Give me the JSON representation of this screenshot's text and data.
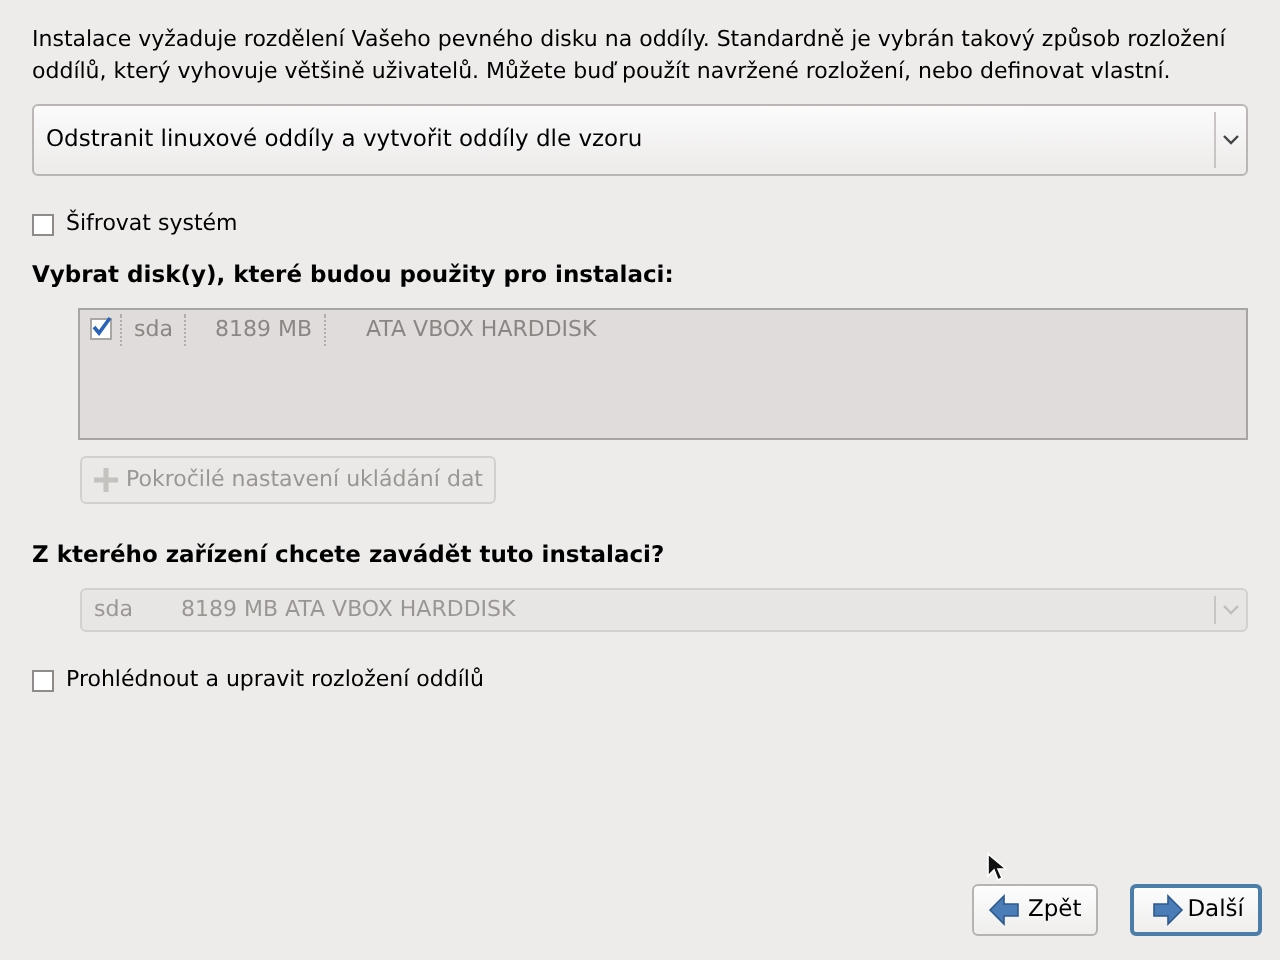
{
  "intro": "Instalace vyžaduje rozdělení Vašeho pevného disku na oddíly. Standardně je vybrán takový způsob rozložení oddílů, který vyhovuje většině uživatelů. Můžete buď použít navržené rozložení, nebo definovat vlastní.",
  "layout_select": {
    "value": "Odstranit linuxové oddíly a vytvořit oddíly dle vzoru",
    "disabled": false
  },
  "encrypt": {
    "label": "Šifrovat systém",
    "checked": false
  },
  "disks_heading": "Vybrat disk(y), které budou použity pro instalaci:",
  "disks": {
    "disabled": true,
    "rows": [
      {
        "checked": true,
        "name": "sda",
        "size": "8189 MB",
        "model": "ATA VBOX HARDDISK"
      }
    ]
  },
  "advanced_button": {
    "label": "Pokročilé nastavení ukládání dat",
    "disabled": true
  },
  "boot_heading": "Z kterého zařízení chcete zavádět tuto instalaci?",
  "boot_select": {
    "device": "sda",
    "description": "8189 MB ATA VBOX HARDDISK",
    "disabled": true
  },
  "review": {
    "label": "Prohlédnout a upravit rozložení oddílů",
    "checked": false
  },
  "buttons": [
    {
      "kind": "back",
      "label": "Zpět",
      "focused": false
    },
    {
      "kind": "next",
      "label": "Další",
      "focused": true
    }
  ]
}
